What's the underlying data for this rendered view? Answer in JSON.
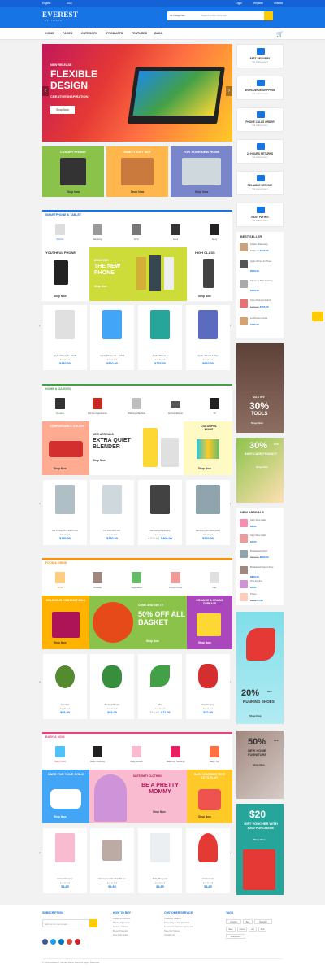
{
  "topbar": {
    "language": "English",
    "currency": "USD",
    "login": "Login",
    "register": "Register",
    "wishlist": "Wishlist"
  },
  "header": {
    "logo": "EVEREST",
    "logo_sub": "ULTIMATE",
    "search_category": "All Categories",
    "search_placeholder": "Search entire store here"
  },
  "nav": [
    "HOME",
    "PAGES",
    "CATEGORY",
    "PRODUCTS",
    "FEATURES",
    "BLOG"
  ],
  "slider": {
    "kicker": "NEW RELEASE",
    "line1": "FLEXIBLE",
    "line2": "DESIGN",
    "line3": "CREATIVE INSPIRATION",
    "button": "Shop Now"
  },
  "promos": [
    {
      "title": "LUXURY PHONE",
      "button": "Shop Now",
      "color": "#8bc34a"
    },
    {
      "title": "SWEET GIFT SET",
      "button": "Shop Now",
      "color": "#ffb74d"
    },
    {
      "title": "FOR YOUR NEW HOME",
      "button": "Shop Now",
      "color": "#7986cb"
    }
  ],
  "services": [
    {
      "label": "FAST DELIVERY",
      "sub": "Vel ut accumsan"
    },
    {
      "label": "WORLDWIDE SHIPPING",
      "sub": "Vel ut accumsan"
    },
    {
      "label": "PHONE CALLS ORDER",
      "sub": "Vel ut accumsan"
    },
    {
      "label": "24 HOURS RETURNS",
      "sub": "Vel ut accumsan"
    },
    {
      "label": "RELIABLE SERVICE",
      "sub": "Vel ut accumsan"
    },
    {
      "label": "EASY PAYING",
      "sub": "Vel ut accumsan"
    }
  ],
  "bestseller": {
    "title": "BEST SELLER",
    "items": [
      {
        "name": "Nullam Malesuada",
        "price": "$400.00",
        "old": "$535.00"
      },
      {
        "name": "Apple iPhone 6 iPhone",
        "price": "$520.00"
      },
      {
        "name": "Samsung 8KG Washing",
        "price": "$150.00"
      },
      {
        "name": "Sony Products Refurb",
        "price": "$155.00",
        "old": "$299.00"
      },
      {
        "name": "Le Mondes Gentle",
        "price": "$475.00"
      }
    ]
  },
  "side_banners": [
    {
      "big": "30%",
      "mid": "TOOLS",
      "top": "SALE OFF",
      "btn": "Shop Now"
    },
    {
      "big": "30%",
      "mid": "BABY CARE PRODUCT",
      "top": "OFF",
      "btn": "Shop Now"
    }
  ],
  "newarrivals": {
    "title": "NEW ARRIVALS",
    "items": [
      {
        "name": "Salty Wine Hallet",
        "price": "$4.85"
      },
      {
        "name": "Salty Wine Hallet",
        "price": "$4.95"
      },
      {
        "name": "Breakfasted Mirror",
        "price": "$860.00",
        "old": "$990.00"
      },
      {
        "name": "Breakfasted Velvet Toilet",
        "price": "$860.00"
      },
      {
        "name": "First birthday",
        "price": "$4.85"
      },
      {
        "name": "Printer",
        "price": "$4.85",
        "old": "$5.00"
      }
    ]
  },
  "side_banners2": [
    {
      "big": "20%",
      "mid": "RUNNING SHOES",
      "top": "OFF",
      "btn": "Shop Now"
    },
    {
      "big": "50%",
      "top": "OFF",
      "mid": "NEW HOME FURNITURE",
      "btn": "Shop Now"
    },
    {
      "big": "$20",
      "mid": "GIFT VOUCHER WITH $200 PURCHASE",
      "btn": "Shop Now"
    }
  ],
  "sections": [
    {
      "title": "SMARTPHONE & TABLET",
      "color": "#1674e4",
      "cats": [
        "iPhone",
        "Samsung",
        "HTC",
        "Asus",
        "Sony"
      ],
      "banners": {
        "left": "YOUTHFUL PHONE",
        "mid_small": "DISCOVER",
        "mid": "THE NEW PHONE",
        "right": "HIGH CLASS",
        "btn": "Shop Now"
      },
      "products": [
        {
          "name": "Apple iPhone 5 - 32GB",
          "price": "$330.00"
        },
        {
          "name": "Apple iPhone 5s - 16GB",
          "price": "$520.00"
        },
        {
          "name": "Apple iPhone 6",
          "price": "$725.00"
        },
        {
          "name": "Apple iPhone 6 Plus",
          "price": "$860.00"
        }
      ]
    },
    {
      "title": "HOME & GARDEN",
      "color": "#43a047",
      "cats": [
        "Speaker",
        "Kitchen Appliances",
        "Washing Machine",
        "Air Conditioner",
        "TV"
      ],
      "banners": {
        "left": "COMFORTABLE COUCH",
        "mid_small": "NEW ARRIVALS",
        "mid": "EXTRA QUIET BLENDER",
        "right": "COLORFUL MUGS",
        "btn": "Shop Now"
      },
      "products": [
        {
          "name": "GE Profile PFSS6PKXSS",
          "price": "$150.00"
        },
        {
          "name": "LG LFX25973ST",
          "price": "$330.00"
        },
        {
          "name": "Samsung Appliance",
          "price": "$400.00",
          "old": "$705.00"
        },
        {
          "name": "Samsung RF4289HARS",
          "price": "$520.00"
        }
      ]
    },
    {
      "title": "FOOD & DRINK",
      "color": "#ff8f00",
      "cats": [
        "Meat",
        "Cereals",
        "Vegetables",
        "Frozen Food",
        "Milk"
      ],
      "banners": {
        "left": "DELICIOUS COCONUT MILK",
        "mid_small": "COME AND GET IT!",
        "mid": "50% OFF ALL BASKET",
        "right": "ORGANIC & GRAINS CEREALS",
        "btn": "Shop Now"
      },
      "products": [
        {
          "name": "Avocado",
          "price": "$58.00"
        },
        {
          "name": "Broccoli Bunch",
          "price": "$45.00"
        },
        {
          "name": "Mint",
          "price": "$11.00",
          "old": "$14.00"
        },
        {
          "name": "Red Pepper",
          "price": "$10.00"
        }
      ]
    },
    {
      "title": "BABY & MOM",
      "color": "#ec407a",
      "cats": [
        "Baby Food",
        "Baby Clothing",
        "Baby Shoes",
        "Maternity Clothing",
        "Baby Toy"
      ],
      "banners": {
        "left": "CARE FOR YOUR CHILD",
        "mid_small": "MATERNITY CLOTHING",
        "mid": "BE A PRETTY MOMMY",
        "right": "BABY LEARNING TOYS LET'S PLAY!",
        "btn": "Shop Now"
      },
      "products": [
        {
          "name": "Dotted Romper",
          "price": "$4.85"
        },
        {
          "name": "Mommy's Little Pink Shoes",
          "price": "$4.85"
        },
        {
          "name": "Baby Bodysuit",
          "price": "$4.85"
        },
        {
          "name": "Knitted Hat",
          "price": "$4.85"
        }
      ]
    }
  ],
  "footer": {
    "subscription": "SUBSCRIPTION",
    "email_placeholder": "Sign up for your email ...",
    "how": "HOW TO BUY",
    "how_links": [
      "Create an Account",
      "Making Payments",
      "Delivery Options",
      "Buyer Protection",
      "New User Guide"
    ],
    "cs": "CUSTOMER SERVICE",
    "cs_links": [
      "Customer Support",
      "Frequently Asked Question",
      "Transaction Service Agreement",
      "Take Our Survey",
      "Contact Us"
    ],
    "tags": "TAGS",
    "tag_list": [
      "watches",
      "Bed",
      "Beautiful",
      "Sexy",
      "Lorem",
      "Girl",
      "Red",
      "smartphone"
    ],
    "copyright": "© 2016 EVEREST Ultimate Demo Store. All Rights Reserved."
  }
}
